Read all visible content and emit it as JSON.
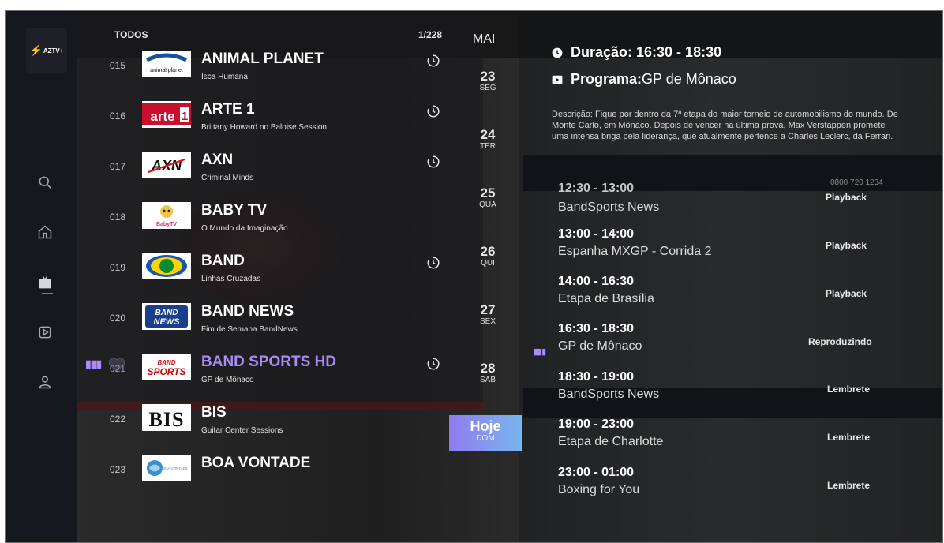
{
  "app": {
    "logo_text": "AZTV+"
  },
  "sidebar": {
    "items": [
      {
        "name": "search",
        "icon": "search-icon"
      },
      {
        "name": "home",
        "icon": "home-icon"
      },
      {
        "name": "tv",
        "icon": "tv-icon",
        "active": true
      },
      {
        "name": "vod",
        "icon": "play-square-icon"
      },
      {
        "name": "profile",
        "icon": "user-icon"
      }
    ]
  },
  "channel_list": {
    "category": "TODOS",
    "counter": "1/228",
    "channels": [
      {
        "number": "015",
        "name": "ANIMAL PLANET",
        "program": "Isca Humana",
        "logo": "animal planet",
        "catchup": true
      },
      {
        "number": "016",
        "name": "ARTE 1",
        "program": "Brittany Howard no Baloise Session",
        "logo": "arte 1",
        "catchup": true
      },
      {
        "number": "017",
        "name": "AXN",
        "program": "Criminal Minds",
        "logo": "AXN",
        "catchup": true
      },
      {
        "number": "018",
        "name": "BABY TV",
        "program": "O Mundo da Imaginação",
        "logo": "BabyTV",
        "catchup": false
      },
      {
        "number": "019",
        "name": "BAND",
        "program": "Linhas Cruzadas",
        "logo": "Band",
        "catchup": true
      },
      {
        "number": "020",
        "name": "BAND NEWS",
        "program": "Fim de Semana BandNews",
        "logo": "BAND NEWS",
        "catchup": false
      },
      {
        "number": "021",
        "name": "BAND SPORTS HD",
        "program": "GP de Mônaco",
        "logo": "BAND SPORTS",
        "catchup": true,
        "selected": true
      },
      {
        "number": "022",
        "name": "BIS",
        "program": "Guitar Center Sessions",
        "logo": "BIS",
        "catchup": false
      },
      {
        "number": "023",
        "name": "BOA VONTADE",
        "program": "",
        "logo": "BOA VONTADE",
        "catchup": false
      }
    ]
  },
  "dates": {
    "month": "MAI",
    "days": [
      {
        "num": "23",
        "name": "SEG"
      },
      {
        "num": "24",
        "name": "TER"
      },
      {
        "num": "25",
        "name": "QUA"
      },
      {
        "num": "26",
        "name": "QUI"
      },
      {
        "num": "27",
        "name": "SEX"
      },
      {
        "num": "28",
        "name": "SAB"
      }
    ],
    "today": {
      "label": "Hoje",
      "name": "DOM"
    }
  },
  "program_info": {
    "duration_label": "Duração: 16:30 - 18:30",
    "program_prefix": "Programa:",
    "program_name": "GP de Mônaco",
    "description": "Descrição:  Fique por dentro da 7ª etapa do maior torneio de automobilismo do mundo. De Monte Carlo, em Mônaco. Depois de vencer na última prova, Max Verstappen promete uma intensa briga pela liderança, que atualmente pertence a Charles Leclerc, da Ferrari."
  },
  "background": {
    "phone": "0800 720 1234"
  },
  "epg": [
    {
      "time": "12:30 - 13:00",
      "title": "BandSports News",
      "action": "Playback"
    },
    {
      "time": "13:00 - 14:00",
      "title": "Espanha MXGP - Corrida 2",
      "action": "Playback"
    },
    {
      "time": "14:00 - 16:30",
      "title": "Etapa de Brasília",
      "action": "Playback"
    },
    {
      "time": "16:30 - 18:30",
      "title": "GP de Mônaco",
      "action": "Reproduzindo"
    },
    {
      "time": "18:30 - 19:00",
      "title": "BandSports News",
      "action": "Lembrete"
    },
    {
      "time": "19:00 - 23:00",
      "title": "Etapa de Charlotte",
      "action": "Lembrete"
    },
    {
      "time": "23:00 - 01:00",
      "title": "Boxing for You",
      "action": "Lembrete"
    }
  ],
  "colors": {
    "accent": "#a98df7",
    "today_gradient_start": "#8f7bf0",
    "today_gradient_end": "#79b6ef"
  }
}
